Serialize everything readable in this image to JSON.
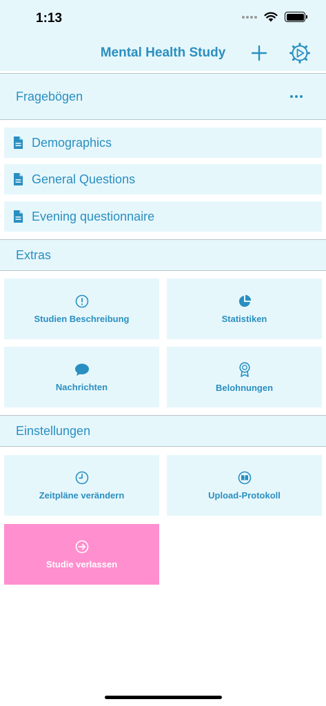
{
  "status_bar": {
    "time": "1:13"
  },
  "nav": {
    "title": "Mental Health Study"
  },
  "sections": {
    "questionnaires": "Fragebögen",
    "extras": "Extras",
    "settings": "Einstellungen"
  },
  "questionnaires": [
    {
      "label": "Demographics",
      "icon": "document-icon"
    },
    {
      "label": "General Questions",
      "icon": "document-icon"
    },
    {
      "label": "Evening questionnaire",
      "icon": "document-icon"
    }
  ],
  "extras": [
    {
      "label": "Studien Beschreibung",
      "icon": "info-icon"
    },
    {
      "label": "Statistiken",
      "icon": "pie-chart-icon"
    },
    {
      "label": "Nachrichten",
      "icon": "chat-bubble-icon"
    },
    {
      "label": "Belohnungen",
      "icon": "award-icon"
    }
  ],
  "settings": [
    {
      "label": "Zeitpläne verändern",
      "icon": "clock-icon"
    },
    {
      "label": "Upload-Protokoll",
      "icon": "book-icon"
    },
    {
      "label": "Studie verlassen",
      "icon": "exit-icon"
    }
  ],
  "colors": {
    "accent": "#2a8fc0",
    "tile_background": "#e6f7fc",
    "danger_tile": "#ff8fce",
    "divider": "#b8c4c9"
  }
}
